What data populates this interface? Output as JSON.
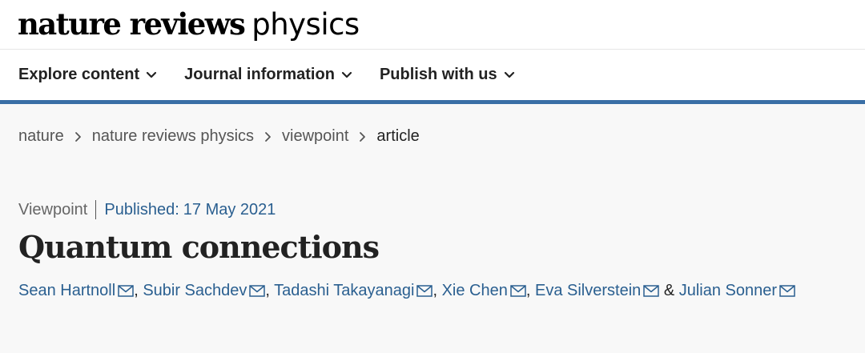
{
  "brand": {
    "journal_name": "nature reviews",
    "journal_subject": "physics"
  },
  "nav": {
    "items": [
      {
        "label": "Explore content",
        "icon": "chevron-down-icon"
      },
      {
        "label": "Journal information",
        "icon": "chevron-down-icon"
      },
      {
        "label": "Publish with us",
        "icon": "chevron-down-icon"
      }
    ]
  },
  "breadcrumb": [
    "nature",
    "nature reviews physics",
    "viewpoint",
    "article"
  ],
  "article": {
    "type": "Viewpoint",
    "published_label": "Published:",
    "published_date": "17 May 2021",
    "title": "Quantum connections",
    "authors": [
      "Sean Hartnoll",
      "Subir Sachdev",
      "Tadashi Takayanagi",
      "Xie Chen",
      "Eva Silverstein",
      "Julian Sonner"
    ],
    "author_separator": ", ",
    "last_separator": " & ",
    "author_icon": "mail-icon"
  },
  "colors": {
    "accent": "#3a6fa6",
    "link": "#2a5f90",
    "background": "#f8f8f8",
    "text": "#222222"
  }
}
